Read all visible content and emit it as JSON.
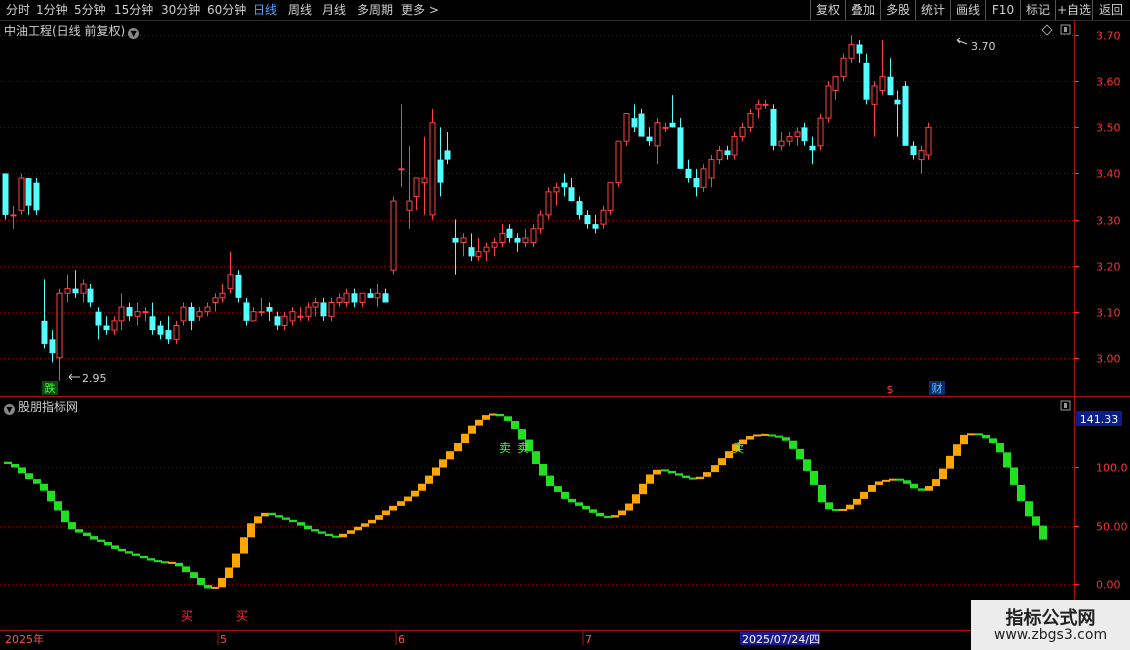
{
  "toolbar": {
    "periods": [
      "分时",
      "1分钟",
      "5分钟",
      "15分钟",
      "30分钟",
      "60分钟",
      "日线",
      "周线",
      "月线",
      "多周期",
      "更多 >"
    ],
    "active_index": 6,
    "right_buttons": [
      "复权",
      "叠加",
      "多股",
      "统计",
      "画线",
      "F10",
      "标记",
      "+自选",
      "返回"
    ]
  },
  "main_panel": {
    "title": "中油工程(日线 前复权)",
    "price_ticks": [
      "3.70",
      "3.60",
      "3.50",
      "3.40",
      "3.30",
      "3.20",
      "3.10",
      "3.00"
    ],
    "high_label": "3.70",
    "low_label": "2.95",
    "event_markers": [
      "跌",
      "$",
      "财"
    ]
  },
  "indicator_panel": {
    "title": "股朋指标网",
    "ticks": [
      "100.0",
      "50.00",
      "0.00"
    ],
    "current_value": "141.33",
    "signal_labels": {
      "buy": "买",
      "sell": "卖"
    }
  },
  "date_axis": {
    "labels": [
      "2025年",
      "5",
      "6",
      "7"
    ],
    "cursor_date": "2025/07/24/四"
  },
  "watermark": {
    "line1": "指标公式网",
    "line2": "www.zbgs3.com"
  },
  "colors": {
    "up": "#ff4040",
    "down": "#54ffff",
    "ind_up": "#ffa500",
    "ind_down": "#20e020",
    "grid": "#8b0000",
    "axis": "#ff3030",
    "accent": "#4aa3ff"
  },
  "chart_data": [
    {
      "type": "candlestick",
      "title": "中油工程(日线 前复权)",
      "ylim": [
        2.93,
        3.72
      ],
      "ticks": [
        3.7,
        3.6,
        3.5,
        3.4,
        3.3,
        3.2,
        3.1,
        3.0
      ],
      "ohlc": [
        [
          3.4,
          3.4,
          3.3,
          3.31
        ],
        [
          3.31,
          3.33,
          3.28,
          3.31
        ],
        [
          3.32,
          3.4,
          3.31,
          3.39
        ],
        [
          3.39,
          3.39,
          3.31,
          3.33
        ],
        [
          3.38,
          3.39,
          3.31,
          3.32
        ],
        [
          3.08,
          3.17,
          3.02,
          3.03
        ],
        [
          3.04,
          3.06,
          2.99,
          3.01
        ],
        [
          3.0,
          3.15,
          2.95,
          3.14
        ],
        [
          3.14,
          3.18,
          3.12,
          3.15
        ],
        [
          3.15,
          3.19,
          3.13,
          3.14
        ],
        [
          3.14,
          3.17,
          3.12,
          3.16
        ],
        [
          3.15,
          3.16,
          3.11,
          3.12
        ],
        [
          3.1,
          3.11,
          3.04,
          3.07
        ],
        [
          3.07,
          3.09,
          3.05,
          3.06
        ],
        [
          3.06,
          3.09,
          3.05,
          3.08
        ],
        [
          3.08,
          3.14,
          3.06,
          3.11
        ],
        [
          3.11,
          3.12,
          3.08,
          3.09
        ],
        [
          3.09,
          3.12,
          3.07,
          3.1
        ],
        [
          3.1,
          3.11,
          3.08,
          3.1
        ],
        [
          3.09,
          3.12,
          3.05,
          3.06
        ],
        [
          3.07,
          3.08,
          3.04,
          3.05
        ],
        [
          3.06,
          3.09,
          3.03,
          3.04
        ],
        [
          3.04,
          3.08,
          3.03,
          3.07
        ],
        [
          3.08,
          3.12,
          3.07,
          3.11
        ],
        [
          3.11,
          3.12,
          3.06,
          3.08
        ],
        [
          3.09,
          3.11,
          3.08,
          3.1
        ],
        [
          3.1,
          3.12,
          3.09,
          3.11
        ],
        [
          3.12,
          3.14,
          3.1,
          3.13
        ],
        [
          3.13,
          3.16,
          3.12,
          3.14
        ],
        [
          3.15,
          3.23,
          3.14,
          3.18
        ],
        [
          3.18,
          3.19,
          3.12,
          3.13
        ],
        [
          3.12,
          3.13,
          3.07,
          3.08
        ],
        [
          3.08,
          3.11,
          3.08,
          3.1
        ],
        [
          3.1,
          3.13,
          3.09,
          3.1
        ],
        [
          3.11,
          3.12,
          3.08,
          3.1
        ],
        [
          3.09,
          3.1,
          3.06,
          3.07
        ],
        [
          3.07,
          3.1,
          3.06,
          3.09
        ],
        [
          3.08,
          3.11,
          3.07,
          3.1
        ],
        [
          3.09,
          3.11,
          3.08,
          3.09
        ],
        [
          3.09,
          3.12,
          3.08,
          3.11
        ],
        [
          3.11,
          3.13,
          3.09,
          3.12
        ],
        [
          3.12,
          3.13,
          3.08,
          3.09
        ],
        [
          3.09,
          3.13,
          3.08,
          3.12
        ],
        [
          3.12,
          3.14,
          3.11,
          3.13
        ],
        [
          3.12,
          3.15,
          3.11,
          3.14
        ],
        [
          3.14,
          3.15,
          3.11,
          3.12
        ],
        [
          3.12,
          3.14,
          3.11,
          3.14
        ],
        [
          3.14,
          3.15,
          3.13,
          3.13
        ],
        [
          3.13,
          3.16,
          3.11,
          3.14
        ],
        [
          3.14,
          3.15,
          3.12,
          3.12
        ],
        [
          3.19,
          3.35,
          3.18,
          3.34
        ],
        [
          3.41,
          3.55,
          3.37,
          3.41
        ],
        [
          3.32,
          3.46,
          3.28,
          3.34
        ],
        [
          3.35,
          3.39,
          3.32,
          3.39
        ],
        [
          3.38,
          3.48,
          3.31,
          3.39
        ],
        [
          3.31,
          3.54,
          3.3,
          3.51
        ],
        [
          3.43,
          3.5,
          3.35,
          3.38
        ],
        [
          3.45,
          3.49,
          3.42,
          3.43
        ],
        [
          3.26,
          3.3,
          3.18,
          3.25
        ],
        [
          3.25,
          3.27,
          3.22,
          3.26
        ],
        [
          3.24,
          3.27,
          3.21,
          3.22
        ],
        [
          3.22,
          3.26,
          3.21,
          3.23
        ],
        [
          3.23,
          3.25,
          3.21,
          3.24
        ],
        [
          3.24,
          3.26,
          3.22,
          3.25
        ],
        [
          3.25,
          3.29,
          3.24,
          3.27
        ],
        [
          3.28,
          3.29,
          3.25,
          3.26
        ],
        [
          3.26,
          3.27,
          3.23,
          3.25
        ],
        [
          3.25,
          3.28,
          3.24,
          3.26
        ],
        [
          3.25,
          3.29,
          3.24,
          3.28
        ],
        [
          3.28,
          3.32,
          3.27,
          3.31
        ],
        [
          3.31,
          3.37,
          3.3,
          3.36
        ],
        [
          3.36,
          3.38,
          3.33,
          3.37
        ],
        [
          3.38,
          3.4,
          3.35,
          3.37
        ],
        [
          3.37,
          3.39,
          3.34,
          3.34
        ],
        [
          3.34,
          3.35,
          3.3,
          3.31
        ],
        [
          3.31,
          3.32,
          3.28,
          3.29
        ],
        [
          3.29,
          3.31,
          3.27,
          3.28
        ],
        [
          3.29,
          3.33,
          3.28,
          3.32
        ],
        [
          3.32,
          3.38,
          3.31,
          3.38
        ],
        [
          3.38,
          3.47,
          3.37,
          3.47
        ],
        [
          3.47,
          3.53,
          3.46,
          3.53
        ],
        [
          3.52,
          3.55,
          3.49,
          3.5
        ],
        [
          3.53,
          3.54,
          3.49,
          3.48
        ],
        [
          3.48,
          3.5,
          3.46,
          3.47
        ],
        [
          3.46,
          3.52,
          3.42,
          3.51
        ],
        [
          3.5,
          3.51,
          3.49,
          3.5
        ],
        [
          3.51,
          3.57,
          3.5,
          3.5
        ],
        [
          3.5,
          3.52,
          3.43,
          3.41
        ],
        [
          3.41,
          3.43,
          3.38,
          3.39
        ],
        [
          3.39,
          3.41,
          3.35,
          3.37
        ],
        [
          3.37,
          3.42,
          3.36,
          3.41
        ],
        [
          3.39,
          3.44,
          3.37,
          3.43
        ],
        [
          3.43,
          3.46,
          3.42,
          3.45
        ],
        [
          3.45,
          3.46,
          3.43,
          3.44
        ],
        [
          3.44,
          3.49,
          3.43,
          3.48
        ],
        [
          3.48,
          3.51,
          3.47,
          3.5
        ],
        [
          3.5,
          3.54,
          3.49,
          3.53
        ],
        [
          3.54,
          3.56,
          3.52,
          3.55
        ],
        [
          3.55,
          3.56,
          3.54,
          3.55
        ],
        [
          3.54,
          3.55,
          3.45,
          3.46
        ],
        [
          3.46,
          3.49,
          3.45,
          3.47
        ],
        [
          3.47,
          3.49,
          3.46,
          3.48
        ],
        [
          3.48,
          3.5,
          3.46,
          3.49
        ],
        [
          3.5,
          3.51,
          3.46,
          3.47
        ],
        [
          3.46,
          3.48,
          3.42,
          3.45
        ],
        [
          3.46,
          3.53,
          3.45,
          3.52
        ],
        [
          3.52,
          3.6,
          3.51,
          3.59
        ],
        [
          3.58,
          3.61,
          3.56,
          3.61
        ],
        [
          3.61,
          3.66,
          3.6,
          3.65
        ],
        [
          3.65,
          3.7,
          3.64,
          3.68
        ],
        [
          3.68,
          3.69,
          3.64,
          3.66
        ],
        [
          3.64,
          3.66,
          3.55,
          3.56
        ],
        [
          3.55,
          3.6,
          3.48,
          3.59
        ],
        [
          3.58,
          3.69,
          3.57,
          3.61
        ],
        [
          3.61,
          3.65,
          3.57,
          3.57
        ],
        [
          3.56,
          3.58,
          3.48,
          3.55
        ],
        [
          3.59,
          3.6,
          3.46,
          3.46
        ],
        [
          3.46,
          3.47,
          3.43,
          3.44
        ],
        [
          3.43,
          3.46,
          3.4,
          3.45
        ],
        [
          3.44,
          3.51,
          3.43,
          3.5
        ]
      ]
    },
    {
      "type": "bar",
      "title": "股朋指标网",
      "ylim": [
        -38,
        158
      ],
      "ticks": [
        100,
        50,
        0
      ],
      "last_value": 141.33,
      "values": [
        105,
        103,
        100,
        95,
        90,
        86,
        80,
        71,
        63,
        53,
        47,
        44,
        41,
        38,
        36,
        33,
        30,
        28,
        26,
        24,
        22,
        20,
        19,
        18,
        18,
        15,
        10,
        5,
        -1,
        -4,
        -3,
        5,
        14,
        26,
        40,
        52,
        58,
        61,
        59,
        57,
        55,
        53,
        50,
        47,
        45,
        43,
        41,
        40,
        43,
        46,
        49,
        52,
        55,
        59,
        63,
        67,
        71,
        75,
        80,
        86,
        93,
        100,
        107,
        114,
        121,
        129,
        136,
        141,
        145,
        146,
        144,
        140,
        133,
        124,
        114,
        103,
        93,
        84,
        79,
        73,
        70,
        67,
        64,
        61,
        58,
        57,
        59,
        63,
        69,
        77,
        86,
        94,
        98,
        97,
        95,
        93,
        91,
        90,
        92,
        96,
        102,
        108,
        114,
        120,
        124,
        127,
        128,
        128,
        127,
        126,
        123,
        116,
        107,
        97,
        85,
        70,
        64,
        63,
        64,
        68,
        73,
        79,
        85,
        88,
        89,
        90,
        89,
        86,
        82,
        80,
        84,
        90,
        99,
        110,
        120,
        128,
        129,
        128,
        125,
        121,
        113,
        100,
        85,
        71,
        58,
        50,
        38
      ]
    }
  ]
}
